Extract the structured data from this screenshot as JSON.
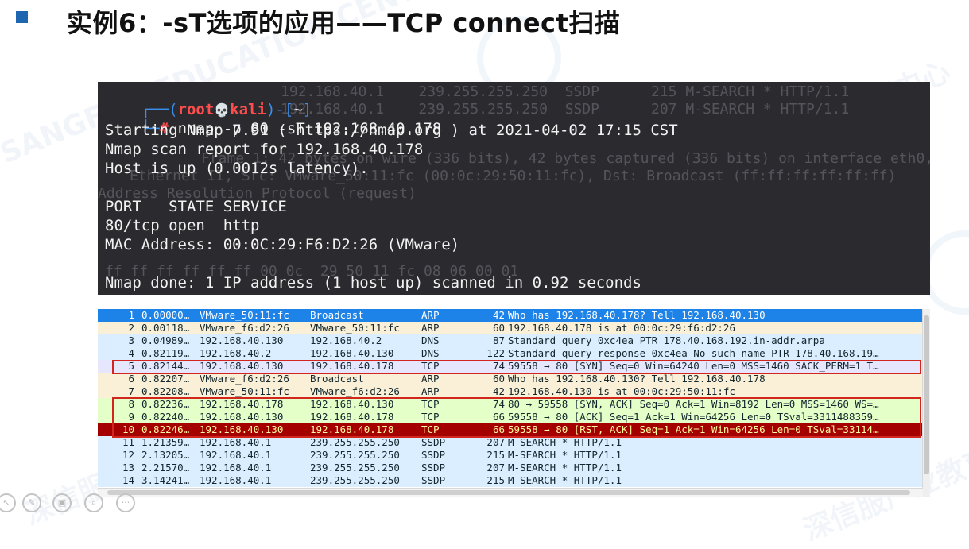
{
  "slide": {
    "title": "实例6：-sT选项的应用——TCP connect扫描"
  },
  "watermark": {
    "text_cn": "深信服产业教育中心",
    "text_en": "SANGFOR EDUCATION CENTER"
  },
  "terminal": {
    "prompt_user": "root",
    "prompt_skull": "💀",
    "prompt_host": "kali",
    "prompt_dir": "~",
    "prompt_symbol": "#",
    "lines": [
      "nmap -p 80 -sT 192.168.40.178",
      "Starting Nmap 7.91 ( https://nmap.org ) at 2021-04-02 17:15 CST",
      "Nmap scan report for 192.168.40.178",
      "Host is up (0.0012s latency).",
      "",
      "PORT   STATE SERVICE",
      "80/tcp open  http",
      "MAC Address: 00:0C:29:F6:D2:26 (VMware)",
      "",
      "Nmap done: 1 IP address (1 host up) scanned in 0.92 seconds"
    ],
    "ghost_text": [
      "192.168.40.1    239.255.255.250  SSDP      215 M-SEARCH * HTTP/1.1",
      "192.168.40.1    239.255.255.250  SSDP      207 M-SEARCH * HTTP/1.1",
      "Frame 1: 42 bytes on wire (336 bits), 42 bytes captured (336 bits) on interface eth0, id 0",
      "Ethernet II, Src: VMware_50:11:fc (00:0c:29:50:11:fc), Dst: Broadcast (ff:ff:ff:ff:ff:ff)",
      "Address Resolution Protocol (request)",
      "ff ff ff ff ff ff 00 0c  29 50 11 fc 08 06 00 01"
    ]
  },
  "packets": [
    {
      "no": "1",
      "time": "0.00000…",
      "src": "VMware_50:11:fc",
      "dst": "Broadcast",
      "proto": "ARP",
      "len": "42",
      "info": "Who has 192.168.40.178? Tell 192.168.40.130",
      "bg": "#1e83e8",
      "fg": "#ffffff"
    },
    {
      "no": "2",
      "time": "0.00118…",
      "src": "VMware_f6:d2:26",
      "dst": "VMware_50:11:fc",
      "proto": "ARP",
      "len": "60",
      "info": "192.168.40.178 is at 00:0c:29:f6:d2:26",
      "bg": "#faf0d7",
      "fg": "#12272e"
    },
    {
      "no": "3",
      "time": "0.04989…",
      "src": "192.168.40.130",
      "dst": "192.168.40.2",
      "proto": "DNS",
      "len": "87",
      "info": "Standard query 0xc4ea PTR 178.40.168.192.in-addr.arpa",
      "bg": "#daeeff",
      "fg": "#12272e"
    },
    {
      "no": "4",
      "time": "0.82119…",
      "src": "192.168.40.2",
      "dst": "192.168.40.130",
      "proto": "DNS",
      "len": "122",
      "info": "Standard query response 0xc4ea No such name PTR 178.40.168.19…",
      "bg": "#daeeff",
      "fg": "#12272e"
    },
    {
      "no": "5",
      "time": "0.82144…",
      "src": "192.168.40.130",
      "dst": "192.168.40.178",
      "proto": "TCP",
      "len": "74",
      "info": "59558 → 80 [SYN] Seq=0 Win=64240 Len=0 MSS=1460 SACK_PERM=1 T…",
      "bg": "#e7e6ff",
      "fg": "#12272e"
    },
    {
      "no": "6",
      "time": "0.82207…",
      "src": "VMware_f6:d2:26",
      "dst": "Broadcast",
      "proto": "ARP",
      "len": "60",
      "info": "Who has 192.168.40.130? Tell 192.168.40.178",
      "bg": "#faf0d7",
      "fg": "#12272e"
    },
    {
      "no": "7",
      "time": "0.82208…",
      "src": "VMware_50:11:fc",
      "dst": "VMware_f6:d2:26",
      "proto": "ARP",
      "len": "42",
      "info": "192.168.40.130 is at 00:0c:29:50:11:fc",
      "bg": "#faf0d7",
      "fg": "#12272e"
    },
    {
      "no": "8",
      "time": "0.82236…",
      "src": "192.168.40.178",
      "dst": "192.168.40.130",
      "proto": "TCP",
      "len": "74",
      "info": "80 → 59558 [SYN, ACK] Seq=0 Ack=1 Win=8192 Len=0 MSS=1460 WS=…",
      "bg": "#e4ffc7",
      "fg": "#12272e"
    },
    {
      "no": "9",
      "time": "0.82240…",
      "src": "192.168.40.130",
      "dst": "192.168.40.178",
      "proto": "TCP",
      "len": "66",
      "info": "59558 → 80 [ACK] Seq=1 Ack=1 Win=64256 Len=0 TSval=3311488359…",
      "bg": "#e4ffc7",
      "fg": "#12272e"
    },
    {
      "no": "10",
      "time": "0.82246…",
      "src": "192.168.40.130",
      "dst": "192.168.40.178",
      "proto": "TCP",
      "len": "66",
      "info": "59558 → 80 [RST, ACK] Seq=1 Ack=1 Win=64256 Len=0 TSval=33114…",
      "bg": "#a40000",
      "fg": "#fffc9c"
    },
    {
      "no": "11",
      "time": "1.21359…",
      "src": "192.168.40.1",
      "dst": "239.255.255.250",
      "proto": "SSDP",
      "len": "207",
      "info": "M-SEARCH * HTTP/1.1",
      "bg": "#daeeff",
      "fg": "#12272e"
    },
    {
      "no": "12",
      "time": "2.13205…",
      "src": "192.168.40.1",
      "dst": "239.255.255.250",
      "proto": "SSDP",
      "len": "215",
      "info": "M-SEARCH * HTTP/1.1",
      "bg": "#daeeff",
      "fg": "#12272e"
    },
    {
      "no": "13",
      "time": "2.21570…",
      "src": "192.168.40.1",
      "dst": "239.255.255.250",
      "proto": "SSDP",
      "len": "207",
      "info": "M-SEARCH * HTTP/1.1",
      "bg": "#daeeff",
      "fg": "#12272e"
    },
    {
      "no": "14",
      "time": "3.14241…",
      "src": "192.168.40.1",
      "dst": "239.255.255.250",
      "proto": "SSDP",
      "len": "215",
      "info": "M-SEARCH * HTTP/1.1",
      "bg": "#daeeff",
      "fg": "#12272e"
    }
  ],
  "highlights": [
    {
      "rows": "5",
      "color": "#d1251e"
    },
    {
      "rows": "8-10",
      "color": "#d1251e"
    }
  ],
  "toolbar": {
    "icons": [
      "pointer-icon",
      "pen-icon",
      "screen-icon",
      "zoom-icon",
      "more-icon"
    ]
  }
}
